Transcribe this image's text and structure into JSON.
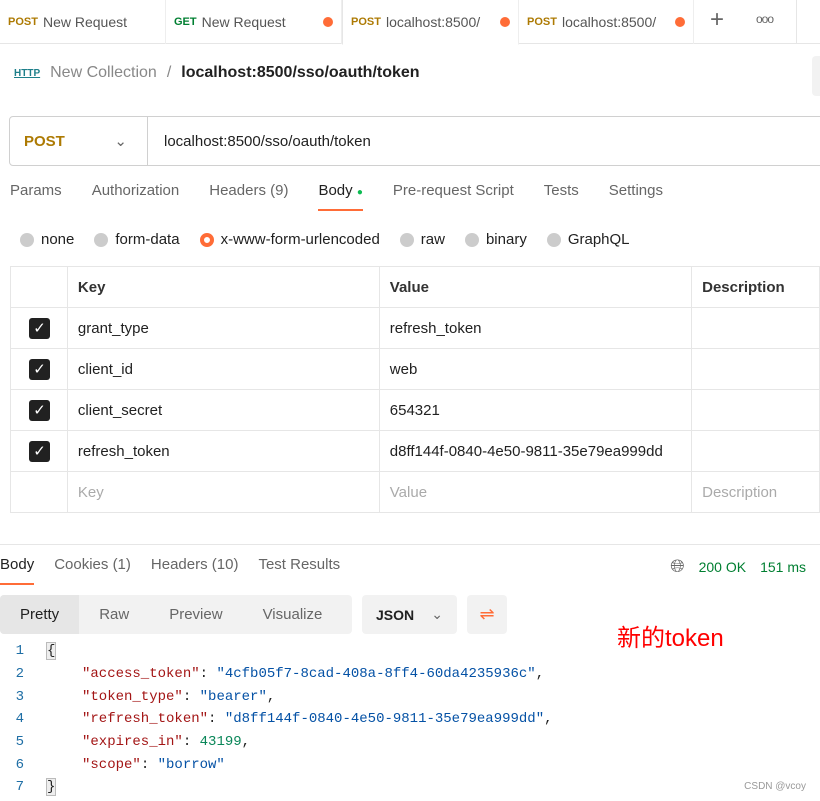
{
  "tabs": [
    {
      "method": "POST",
      "label": "New Request",
      "dot": false
    },
    {
      "method": "GET",
      "label": "New Request",
      "dot": true
    },
    {
      "method": "POST",
      "label": "localhost:8500/",
      "dot": true,
      "active": true
    },
    {
      "method": "POST",
      "label": "localhost:8500/",
      "dot": true
    }
  ],
  "breadcrumb": {
    "collection": "New Collection",
    "sep": "/",
    "request": "localhost:8500/sso/oauth/token",
    "icon": "http-icon"
  },
  "request": {
    "method": "POST",
    "url": "localhost:8500/sso/oauth/token"
  },
  "req_tabs": [
    "Params",
    "Authorization",
    "Headers (9)",
    "Body",
    "Pre-request Script",
    "Tests",
    "Settings"
  ],
  "body_types": [
    "none",
    "form-data",
    "x-www-form-urlencoded",
    "raw",
    "binary",
    "GraphQL"
  ],
  "body_selected": "x-www-form-urlencoded",
  "table": {
    "headers": [
      "Key",
      "Value",
      "Description"
    ],
    "rows": [
      {
        "key": "grant_type",
        "value": "refresh_token"
      },
      {
        "key": "client_id",
        "value": "web"
      },
      {
        "key": "client_secret",
        "value": "654321"
      },
      {
        "key": "refresh_token",
        "value": "d8ff144f-0840-4e50-9811-35e79ea999dd"
      }
    ],
    "placeholder": {
      "key": "Key",
      "value": "Value",
      "description": "Description"
    }
  },
  "resp_tabs": [
    "Body",
    "Cookies (1)",
    "Headers (10)",
    "Test Results"
  ],
  "status": {
    "code": "200 OK",
    "time": "151 ms"
  },
  "views": [
    "Pretty",
    "Raw",
    "Preview",
    "Visualize"
  ],
  "format": "JSON",
  "annotation": "新的token",
  "code": {
    "open": "{",
    "close": "}",
    "lines": [
      {
        "k": "\"access_token\"",
        "v": "\"4cfb05f7-8cad-408a-8ff4-60da4235936c\"",
        "t": "s",
        "c": ","
      },
      {
        "k": "\"token_type\"",
        "v": "\"bearer\"",
        "t": "s",
        "c": ","
      },
      {
        "k": "\"refresh_token\"",
        "v": "\"d8ff144f-0840-4e50-9811-35e79ea999dd\"",
        "t": "s",
        "c": ","
      },
      {
        "k": "\"expires_in\"",
        "v": "43199",
        "t": "n",
        "c": ","
      },
      {
        "k": "\"scope\"",
        "v": "\"borrow\"",
        "t": "s",
        "c": ""
      }
    ]
  },
  "watermark": "CSDN @vcoy",
  "colors": {
    "accent": "#ff6c37",
    "post": "#ad7a03",
    "get": "#007f31"
  }
}
